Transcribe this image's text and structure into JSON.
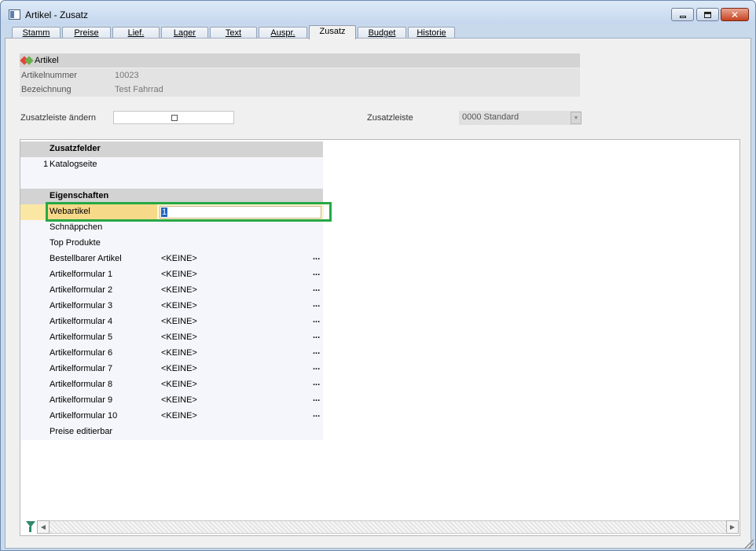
{
  "window": {
    "title": "Artikel - Zusatz"
  },
  "tabs": [
    {
      "label": "Stamm"
    },
    {
      "label": "Preise"
    },
    {
      "label": "Lief."
    },
    {
      "label": "Lager"
    },
    {
      "label": "Text"
    },
    {
      "label": "Auspr."
    },
    {
      "label": "Zusatz"
    },
    {
      "label": "Budget"
    },
    {
      "label": "Historie"
    }
  ],
  "artikel": {
    "section_title": "Artikel",
    "artikelnummer_label": "Artikelnummer",
    "artikelnummer_value": "10023",
    "bezeichnung_label": "Bezeichnung",
    "bezeichnung_value": "Test Fahrrad"
  },
  "zusatzleiste": {
    "aendern_label": "Zusatzleiste ändern",
    "aendern_checked": false,
    "label": "Zusatzleiste",
    "value": "0000 Standard"
  },
  "grid": {
    "zusatzfelder_header": "Zusatzfelder",
    "zusatzfelder": [
      {
        "num": "1",
        "name": "Katalogseite"
      }
    ],
    "eigenschaften_header": "Eigenschaften",
    "selected_row": {
      "name": "Webartikel",
      "edit_value": "1"
    },
    "rows": [
      {
        "name": "Schnäppchen",
        "value": "",
        "dots": ""
      },
      {
        "name": "Top Produkte",
        "value": "",
        "dots": ""
      },
      {
        "name": "Bestellbarer Artikel",
        "value": "<KEINE>",
        "dots": "..."
      },
      {
        "name": "Artikelformular 1",
        "value": "<KEINE>",
        "dots": "..."
      },
      {
        "name": "Artikelformular 2",
        "value": "<KEINE>",
        "dots": "..."
      },
      {
        "name": "Artikelformular 3",
        "value": "<KEINE>",
        "dots": "..."
      },
      {
        "name": "Artikelformular 4",
        "value": "<KEINE>",
        "dots": "..."
      },
      {
        "name": "Artikelformular 5",
        "value": "<KEINE>",
        "dots": "..."
      },
      {
        "name": "Artikelformular 6",
        "value": "<KEINE>",
        "dots": "..."
      },
      {
        "name": "Artikelformular 7",
        "value": "<KEINE>",
        "dots": "..."
      },
      {
        "name": "Artikelformular 8",
        "value": "<KEINE>",
        "dots": "..."
      },
      {
        "name": "Artikelformular 9",
        "value": "<KEINE>",
        "dots": "..."
      },
      {
        "name": "Artikelformular 10",
        "value": "<KEINE>",
        "dots": "..."
      },
      {
        "name": "Preise editierbar",
        "value": "",
        "dots": ""
      }
    ]
  },
  "colors": {
    "selection_frame": "#27a844",
    "selected_row": "#f7d98a",
    "text_selection": "#1f64c2"
  },
  "icons": {
    "app": "window-app-icon",
    "artikel": "artikel-hearts-icon",
    "filter": "filter-icon"
  }
}
